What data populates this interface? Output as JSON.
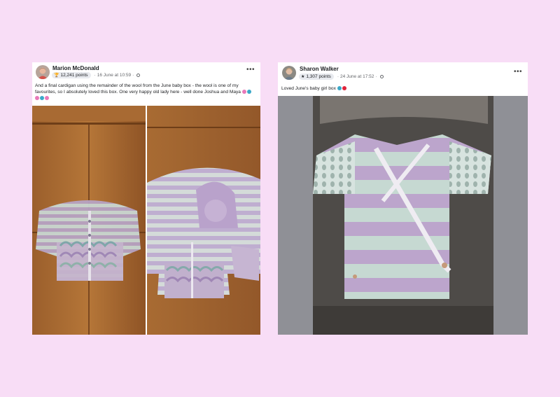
{
  "posts": [
    {
      "author": "Marion McDonald",
      "points": "12,241 points",
      "timestamp": "16 June at 10:59",
      "text": "And a final cardigan using the remainder of the wool from the June baby box - the wool is one of my favourites, so I absolutely loved this box. One very happy old lady here - well done Joshua and Maya",
      "emojis": [
        "pink-heart",
        "blue-circle",
        "pink-heart",
        "blue-circle",
        "pink-heart"
      ],
      "badge_icon": "trophy-icon",
      "images": [
        "cardigan-on-wooden-floor",
        "cardigan-set-with-hat"
      ]
    },
    {
      "author": "Sharon Walker",
      "points": "1,307 points",
      "timestamp": "24 June at 17:52",
      "text": "Loved June's baby girl box",
      "emojis": [
        "blue-circle",
        "red-heart"
      ],
      "badge_icon": "star-icon",
      "images": [
        "wrap-cardigan-on-sofa"
      ]
    }
  ],
  "colors": {
    "background": "#f8ddf6",
    "card": "#ffffff",
    "meta_text": "#65676b",
    "badge_bg": "#e8eaef",
    "emoji_pink": "#e979b9",
    "emoji_blue": "#3aa8c8",
    "emoji_red": "#e0243b"
  }
}
